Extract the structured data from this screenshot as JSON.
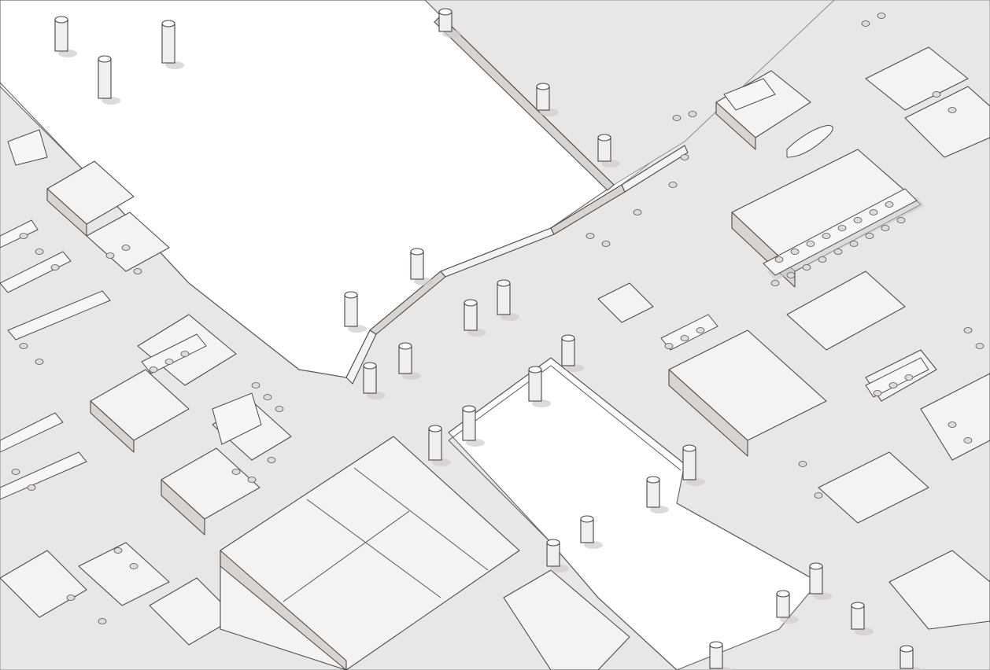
{
  "scene": {
    "kind": "isometric office floor plan",
    "palette": {
      "floor": "#e9e7e6",
      "void": "#ffffff",
      "wall": "#f4f3f2",
      "wall_shade": "#d7d4d2",
      "line": "#4f4c4a"
    },
    "text_labels": []
  }
}
